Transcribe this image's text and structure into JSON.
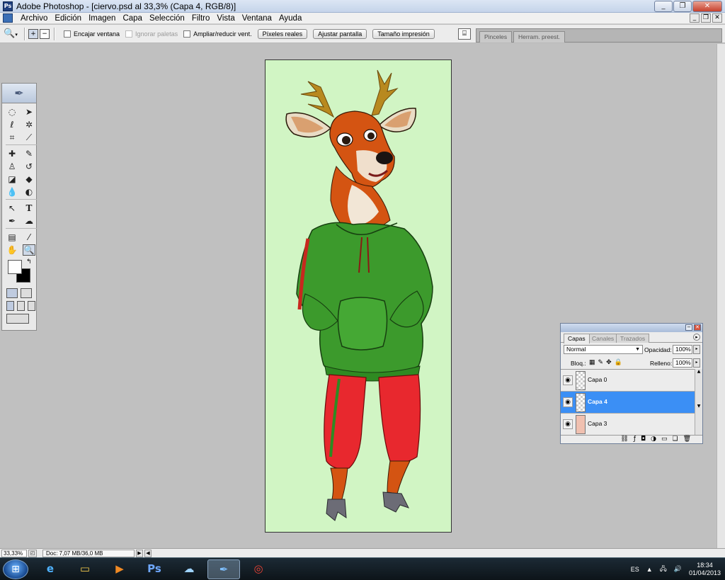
{
  "window": {
    "title": "Adobe Photoshop - [ciervo.psd al 33,3% (Capa 4, RGB/8)]",
    "controls": {
      "minimize": "_",
      "restore": "❐",
      "close": "✕"
    }
  },
  "menu": {
    "items": [
      "Archivo",
      "Edición",
      "Imagen",
      "Capa",
      "Selección",
      "Filtro",
      "Vista",
      "Ventana",
      "Ayuda"
    ]
  },
  "options_bar": {
    "checkboxes": [
      {
        "label": "Encajar ventana",
        "checked": false,
        "disabled": false
      },
      {
        "label": "Ignorar paletas",
        "checked": false,
        "disabled": true
      },
      {
        "label": "Ampliar/reducir vent.",
        "checked": false,
        "disabled": false
      }
    ],
    "buttons": [
      "Píxeles reales",
      "Ajustar pantalla",
      "Tamaño impresión"
    ],
    "palette_well_tabs": [
      "Pinceles",
      "Herram. preest."
    ]
  },
  "toolbox": {
    "tools": [
      "marquee",
      "move",
      "lasso",
      "magic-wand",
      "crop",
      "slice",
      "healing-brush",
      "brush",
      "stamp",
      "history-brush",
      "eraser",
      "paint-bucket",
      "blur",
      "dodge",
      "path-selection",
      "type",
      "pen",
      "custom-shape",
      "notes",
      "eyedropper",
      "hand",
      "zoom"
    ],
    "active_tool": "zoom",
    "foreground_color": "#ffffff",
    "background_color": "#000000"
  },
  "document": {
    "canvas_background": "#d1f5c4"
  },
  "layers_panel": {
    "tabs": [
      "Capas",
      "Canales",
      "Trazados"
    ],
    "active_tab": "Capas",
    "blend_mode": "Normal",
    "opacity_label": "Opacidad:",
    "opacity": "100%",
    "lock_label": "Bloq.:",
    "fill_label": "Relleno:",
    "fill": "100%",
    "layers": [
      {
        "name": "Capa 0",
        "selected": false,
        "visible": true
      },
      {
        "name": "Capa 4",
        "selected": true,
        "visible": true
      },
      {
        "name": "Capa 3",
        "selected": false,
        "visible": true
      }
    ]
  },
  "status_bar": {
    "zoom": "33,33%",
    "doc_info": "Doc: 7,07 MB/36,0 MB"
  },
  "taskbar": {
    "language": "ES",
    "time": "18:34",
    "date": "01/04/2013",
    "pinned": [
      "internet-explorer",
      "file-explorer",
      "media-player",
      "photoshop-ps",
      "network-app",
      "photoshop-cs",
      "chrome"
    ],
    "active_app": "photoshop-cs"
  }
}
